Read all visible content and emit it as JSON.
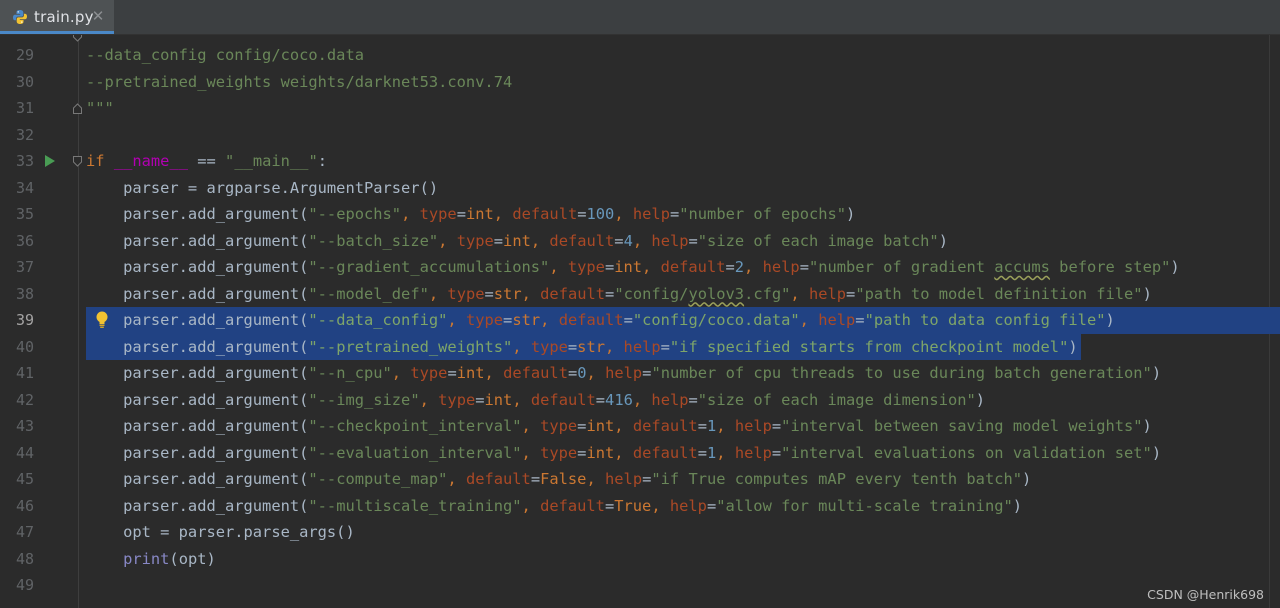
{
  "tab": {
    "filename": "train.py",
    "icon": "python-file-icon",
    "close_glyph": "✕"
  },
  "editor": {
    "selected_lines": [
      39,
      40
    ],
    "current_line": 39,
    "lines": [
      {
        "num": "29",
        "code": "--data_config config/coco.data"
      },
      {
        "num": "30",
        "code": "--pretrained_weights weights/darknet53.conv.74"
      },
      {
        "num": "31",
        "code": "\"\"\""
      },
      {
        "num": "32",
        "code": ""
      },
      {
        "num": "33",
        "code": "if __name__ == \"__main__\":"
      },
      {
        "num": "34",
        "code": "    parser = argparse.ArgumentParser()"
      },
      {
        "num": "35",
        "code": "    parser.add_argument(\"--epochs\", type=int, default=100, help=\"number of epochs\")"
      },
      {
        "num": "36",
        "code": "    parser.add_argument(\"--batch_size\", type=int, default=4, help=\"size of each image batch\")"
      },
      {
        "num": "37",
        "code": "    parser.add_argument(\"--gradient_accumulations\", type=int, default=2, help=\"number of gradient accums before step\")"
      },
      {
        "num": "38",
        "code": "    parser.add_argument(\"--model_def\", type=str, default=\"config/yolov3.cfg\", help=\"path to model definition file\")"
      },
      {
        "num": "39",
        "code": "    parser.add_argument(\"--data_config\", type=str, default=\"config/coco.data\", help=\"path to data config file\")"
      },
      {
        "num": "40",
        "code": "    parser.add_argument(\"--pretrained_weights\", type=str, help=\"if specified starts from checkpoint model\")"
      },
      {
        "num": "41",
        "code": "    parser.add_argument(\"--n_cpu\", type=int, default=0, help=\"number of cpu threads to use during batch generation\")"
      },
      {
        "num": "42",
        "code": "    parser.add_argument(\"--img_size\", type=int, default=416, help=\"size of each image dimension\")"
      },
      {
        "num": "43",
        "code": "    parser.add_argument(\"--checkpoint_interval\", type=int, default=1, help=\"interval between saving model weights\")"
      },
      {
        "num": "44",
        "code": "    parser.add_argument(\"--evaluation_interval\", type=int, default=1, help=\"interval evaluations on validation set\")"
      },
      {
        "num": "45",
        "code": "    parser.add_argument(\"--compute_map\", default=False, help=\"if True computes mAP every tenth batch\")"
      },
      {
        "num": "46",
        "code": "    parser.add_argument(\"--multiscale_training\", default=True, help=\"allow for multi-scale training\")"
      },
      {
        "num": "47",
        "code": "    opt = parser.parse_args()"
      },
      {
        "num": "48",
        "code": "    print(opt)"
      },
      {
        "num": "49",
        "code": ""
      }
    ]
  },
  "watermark": "CSDN @Henrik698",
  "colors": {
    "background": "#2b2b2b",
    "keyword": "#cc7832",
    "string": "#6a8759",
    "number": "#6897bb",
    "param": "#aa4926",
    "dunder": "#b200b2",
    "selection": "#214283",
    "run_icon": "#499c54",
    "bulb": "#f1c232"
  }
}
